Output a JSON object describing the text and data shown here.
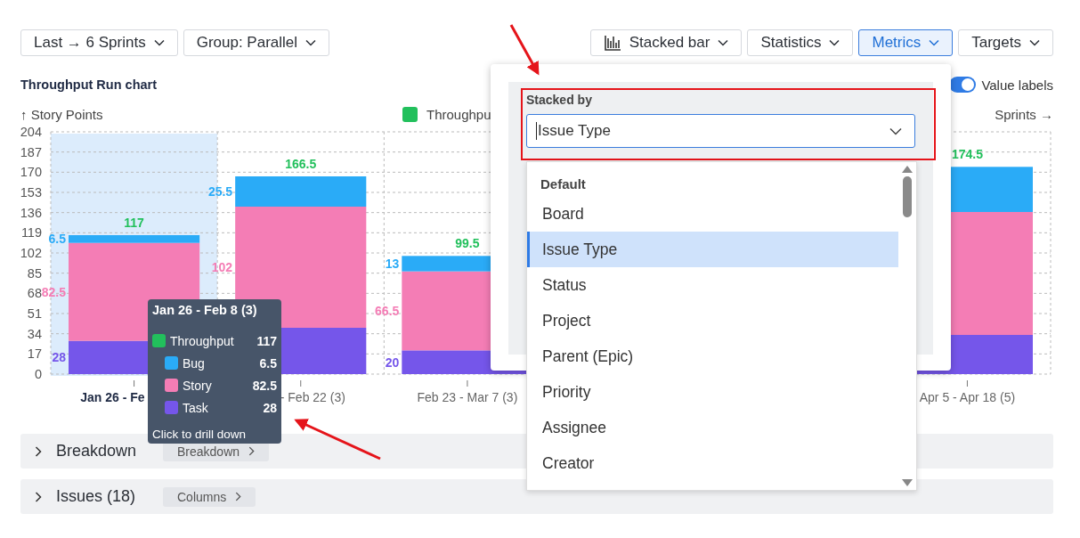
{
  "toolbar": {
    "left": [
      {
        "label": "Last → 6 Sprints",
        "kind": "dropdown",
        "selected": false
      },
      {
        "label": "Group: Parallel",
        "kind": "dropdown",
        "selected": false
      }
    ],
    "right": [
      {
        "label": "Stacked bar",
        "kind": "chart-type",
        "selected": false
      },
      {
        "label": "Statistics",
        "kind": "dropdown",
        "selected": false
      },
      {
        "label": "Metrics",
        "kind": "dropdown",
        "selected": true
      },
      {
        "label": "Targets",
        "kind": "dropdown",
        "selected": false
      }
    ]
  },
  "chart_title": "Throughput Run chart",
  "value_labels_toggle": {
    "label": "Value labels",
    "on": true
  },
  "legend": [
    {
      "label": "Throughpu",
      "color": "#22c05c"
    }
  ],
  "chart": {
    "hovered_columns": [
      true,
      false,
      false,
      false
    ],
    "total_labels": [
      "117",
      "166.5",
      "99.5",
      "174.5"
    ],
    "chart_data": {
      "type": "bar",
      "stacked": true,
      "grid": true,
      "xlabel": "Sprints →",
      "ylabel": "↑ Story Points",
      "categories": [
        "Jan 26 - Fe",
        "- Feb 22 (3)",
        "Feb 23 - Mar 7 (3)",
        "Apr 5 - Apr 18 (5)"
      ],
      "ylim": [
        0,
        204
      ],
      "yticks": [
        0,
        17,
        34,
        51,
        68,
        85,
        102,
        119,
        136,
        153,
        170,
        187,
        204
      ],
      "series": [
        {
          "name": "Task",
          "color": "#7556ea",
          "values": [
            28,
            39,
            20,
            33
          ]
        },
        {
          "name": "Story",
          "color": "#f47db5",
          "values": [
            82.5,
            102,
            66.5,
            103.5
          ]
        },
        {
          "name": "Bug",
          "color": "#2aabf7",
          "values": [
            6.5,
            25.5,
            13,
            38
          ]
        }
      ],
      "value_labels": [
        [
          "28",
          null,
          "20",
          null
        ],
        [
          "82.5",
          "102",
          "66.5",
          null
        ],
        [
          "6.5",
          "25.5",
          "13",
          null
        ]
      ]
    }
  },
  "sections": [
    {
      "title": "Breakdown",
      "expanded": false,
      "chip": "Breakdown"
    },
    {
      "title": "Issues (18)",
      "expanded": false,
      "chip": "Columns"
    }
  ],
  "tooltip": {
    "title": "Jan 26 - Feb 8 (3)",
    "total": {
      "label": "Throughput",
      "value": "117",
      "color": "#22c05c"
    },
    "series_values": [
      "6.5",
      "82.5",
      "28"
    ],
    "footer": "Click to drill down"
  },
  "popover": {
    "label": "Stacked by",
    "value": "Issue Type",
    "options": [
      {
        "kind": "header",
        "label": "Default"
      },
      {
        "kind": "option",
        "label": "Board",
        "selected": false
      },
      {
        "kind": "option",
        "label": "Issue Type",
        "selected": true
      },
      {
        "kind": "option",
        "label": "Status",
        "selected": false
      },
      {
        "kind": "option",
        "label": "Project",
        "selected": false
      },
      {
        "kind": "option",
        "label": "Parent (Epic)",
        "selected": false
      },
      {
        "kind": "option",
        "label": "Priority",
        "selected": false
      },
      {
        "kind": "option",
        "label": "Assignee",
        "selected": false
      },
      {
        "kind": "option",
        "label": "Creator",
        "selected": false
      }
    ]
  }
}
